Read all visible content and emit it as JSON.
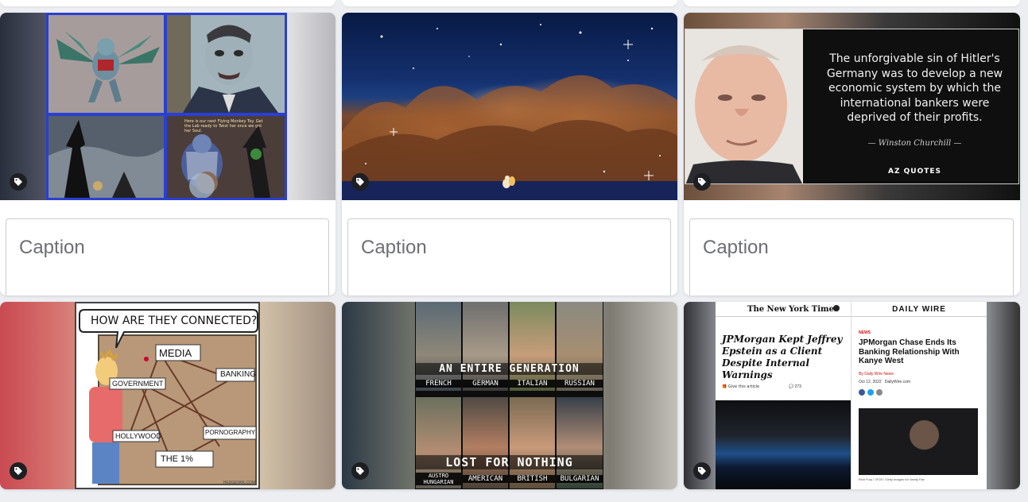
{
  "caption_placeholder": "Caption",
  "cards": [
    {
      "id": "flying-monkeys",
      "has_caption": true,
      "meme_caption": "Here is our next Flying Monkey Toy. Get the Lab ready to Twist her once we get her Soul."
    },
    {
      "id": "space-nebula",
      "has_caption": true
    },
    {
      "id": "churchill-quote",
      "has_caption": true,
      "quote": "The unforgivable sin of Hitler's Germany was to develop a new economic system by which the international bankers were deprived of their profits.",
      "author": "Winston Churchill",
      "brand": "AZ QUOTES"
    },
    {
      "id": "comic",
      "has_caption": false,
      "bubble": "HOW ARE THEY CONNECTED?",
      "labels": [
        "MEDIA",
        "BANKING",
        "GOVERNMENT",
        "HOLLYWOOD",
        "PORNOGRAPHY",
        "THE 1%"
      ],
      "credit": "HEDGEWIK.COM"
    },
    {
      "id": "soldiers",
      "has_caption": false,
      "top_banner": "AN ENTIRE GENERATION",
      "bottom_banner": "LOST FOR NOTHING",
      "top_nations": [
        "FRENCH",
        "GERMAN",
        "ITALIAN",
        "RUSSIAN"
      ],
      "bottom_nations": [
        "AUSTRO HUNGARIAN",
        "AMERICAN",
        "BRITISH",
        "BULGARIAN"
      ]
    },
    {
      "id": "news",
      "has_caption": false,
      "left_masthead": "The New York Times",
      "left_headline": "JPMorgan Kept Jeffrey Epstein as a Client Despite Internal Warnings",
      "left_share": "Give this article",
      "left_comments": "273",
      "right_masthead": "DAILY WIRE",
      "right_section": "NEWS",
      "right_headline": "JPMorgan Chase Ends Its Banking Relationship With Kanye West",
      "right_byline_prefix": "By",
      "right_byline": "Daily Wire News",
      "right_date": "Oct 12, 2022",
      "right_site": "DailyWire.com",
      "right_photo_credit": "Rich Fury / VF20 / Getty Images for Vanity Fair"
    }
  ],
  "colors": {
    "background": "#eceef1",
    "card": "#ffffff",
    "tag_button": "#1e1f22",
    "border": "#c9ccd1"
  },
  "icons": {
    "tag": "tag-icon"
  }
}
